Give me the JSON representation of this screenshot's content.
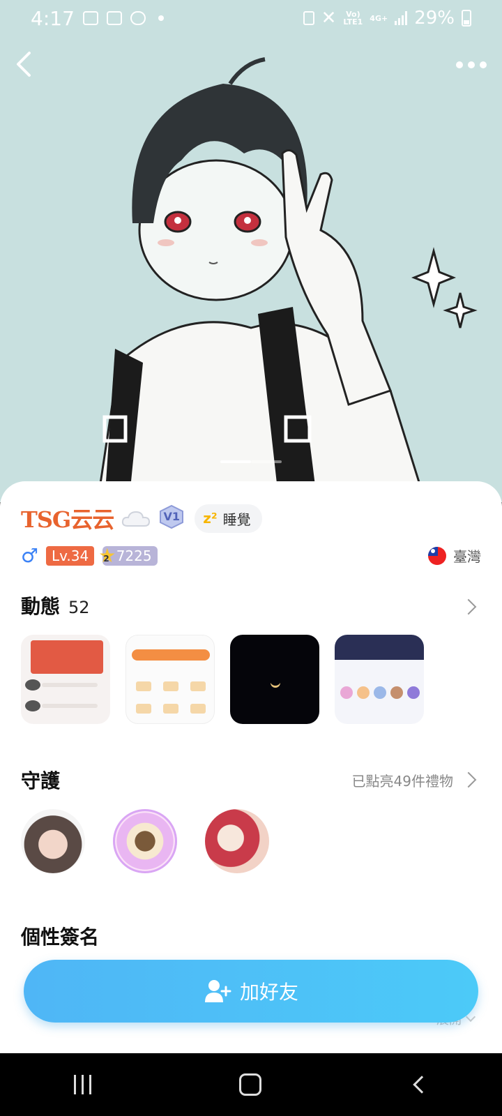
{
  "status_bar": {
    "time": "4:17",
    "net_top": "Vo)",
    "net_bottom": "LTE1",
    "net_type": "4G+",
    "battery": "29%"
  },
  "hero": {
    "pager_active": 1,
    "pager_total": 2
  },
  "profile": {
    "username": "TSG云云",
    "vip": "V1",
    "status": "睡覺",
    "gender_symbol": "♂",
    "level": "Lv.34",
    "points": "7225",
    "star_level": "2",
    "region": "臺灣"
  },
  "moments": {
    "title": "動態",
    "count": "52"
  },
  "guard": {
    "title": "守護",
    "lit_gifts": "已點亮49件禮物"
  },
  "signature": {
    "title": "個性簽名",
    "expand": "展開"
  },
  "actions": {
    "add_friend": "加好友"
  },
  "colors": {
    "accent": "#4fb6f6",
    "username": "#e8632e",
    "level": "#ee6a43"
  },
  "icons": [
    "back-arrow-icon",
    "more-icon",
    "cloud-icon",
    "vip-badge-icon",
    "sleep-icon",
    "male-icon",
    "star-icon",
    "taiwan-flag-icon",
    "chevron-right-icon",
    "add-friend-icon"
  ]
}
